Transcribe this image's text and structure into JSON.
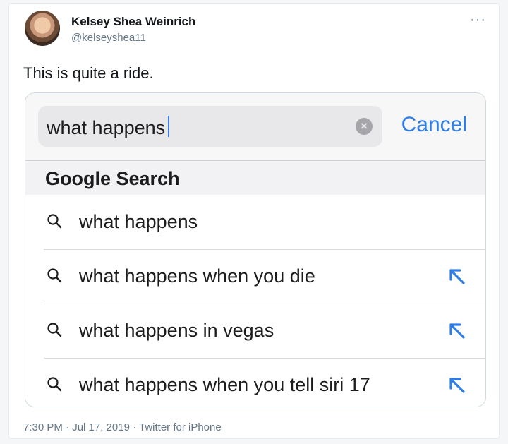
{
  "tweet": {
    "author_name": "Kelsey Shea Weinrich",
    "author_handle": "@kelseyshea11",
    "more_icon": "more-horizontal-icon",
    "text": "This is quite a ride.",
    "footer": "7:30 PM · Jul 17, 2019 · Twitter for iPhone"
  },
  "search": {
    "query": "what happens",
    "cancel_label": "Cancel",
    "section_title": "Google Search",
    "suggestions": [
      {
        "text": "what happens",
        "has_arrow": false
      },
      {
        "text": "what happens when you die",
        "has_arrow": true
      },
      {
        "text": "what happens in vegas",
        "has_arrow": true
      },
      {
        "text": "what happens when you tell siri 17",
        "has_arrow": true
      }
    ]
  },
  "colors": {
    "accent": "#2f7de6",
    "caret": "#3a7de8",
    "text": "#1c1c1e",
    "secondary": "#657786"
  }
}
